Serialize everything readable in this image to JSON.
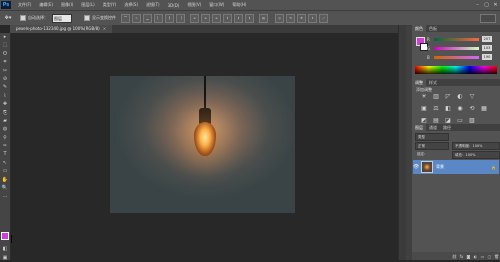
{
  "app": {
    "logo": "Ps"
  },
  "menu": [
    "文件(F)",
    "编辑(E)",
    "图像(I)",
    "图层(L)",
    "类型(Y)",
    "选择(S)",
    "滤镜(T)",
    "3D(D)",
    "视图(V)",
    "窗口(W)",
    "帮助(H)"
  ],
  "window_controls": [
    "–",
    "▢",
    "✕"
  ],
  "options": {
    "auto_select_label": "自动选择：",
    "auto_select_value": "图层",
    "show_transform_label": "显示变换控件"
  },
  "document_tab": {
    "title": "pexels-photo-132340.jpg @ 100%(RGB/8)",
    "close": "×"
  },
  "color_panel": {
    "tabs": [
      "颜色",
      "色板"
    ],
    "fg_color": "#d23fd7",
    "bg_color": "#ffffff",
    "rows": [
      {
        "label": "R",
        "value": "207"
      },
      {
        "label": "G",
        "value": "103"
      },
      {
        "label": "B",
        "value": "190"
      }
    ]
  },
  "adjustments_panel": {
    "tabs": [
      "调整",
      "样式"
    ],
    "title": "添加调整",
    "icons": [
      "brightness-icon",
      "levels-icon",
      "curves-icon",
      "exposure-icon",
      "vibrance-icon",
      "hsl-icon",
      "color-balance-icon",
      "bw-icon",
      "photo-filter-icon",
      "channel-mixer-icon",
      "color-lookup-icon",
      "invert-icon",
      "posterize-icon",
      "threshold-icon",
      "gradient-map-icon",
      "selective-color-icon"
    ],
    "glyphs": [
      "☀",
      "▥",
      "◸",
      "◐",
      "▽",
      "▣",
      "⚖",
      "◧",
      "◉",
      "⟲",
      "▦",
      "◩",
      "▤",
      "◪",
      "▭",
      "▧"
    ]
  },
  "layers_panel": {
    "tabs": [
      "图层",
      "通道",
      "路径"
    ],
    "kind_label": "类型",
    "blend_mode": "正常",
    "opacity_label": "不透明度：100%",
    "lock_label": "锁定：",
    "fill_label": "填充：100%",
    "layer_name": "背景",
    "lock_icon": "🔒"
  },
  "tools": [
    "▸",
    "⬚",
    "ʘ",
    "⌗",
    "✂",
    "⊘",
    "✎",
    "⌇",
    "✚",
    "⎘",
    "▰",
    "◍",
    "⚲",
    "✑",
    "T",
    "↖",
    "▭",
    "✋",
    "🔍",
    "…",
    "◧",
    "▣",
    "⟳"
  ]
}
